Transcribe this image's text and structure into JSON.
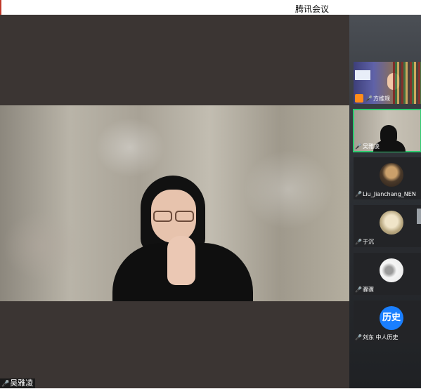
{
  "window": {
    "title": "腾讯会议"
  },
  "main_video": {
    "speaker_name": "吴雅凌"
  },
  "participants": [
    {
      "name": "方维规"
    },
    {
      "name": "吴雅凌"
    },
    {
      "name": "Liu_Jianchang_NEN"
    },
    {
      "name": "于沉"
    },
    {
      "name": "骤骤"
    },
    {
      "name": "刘东 中人历史",
      "avatar_text": "历史"
    }
  ],
  "colors": {
    "active_border": "#2ecc71",
    "avatar_blue": "#1a7fff",
    "stage_bg": "#3b3533"
  }
}
